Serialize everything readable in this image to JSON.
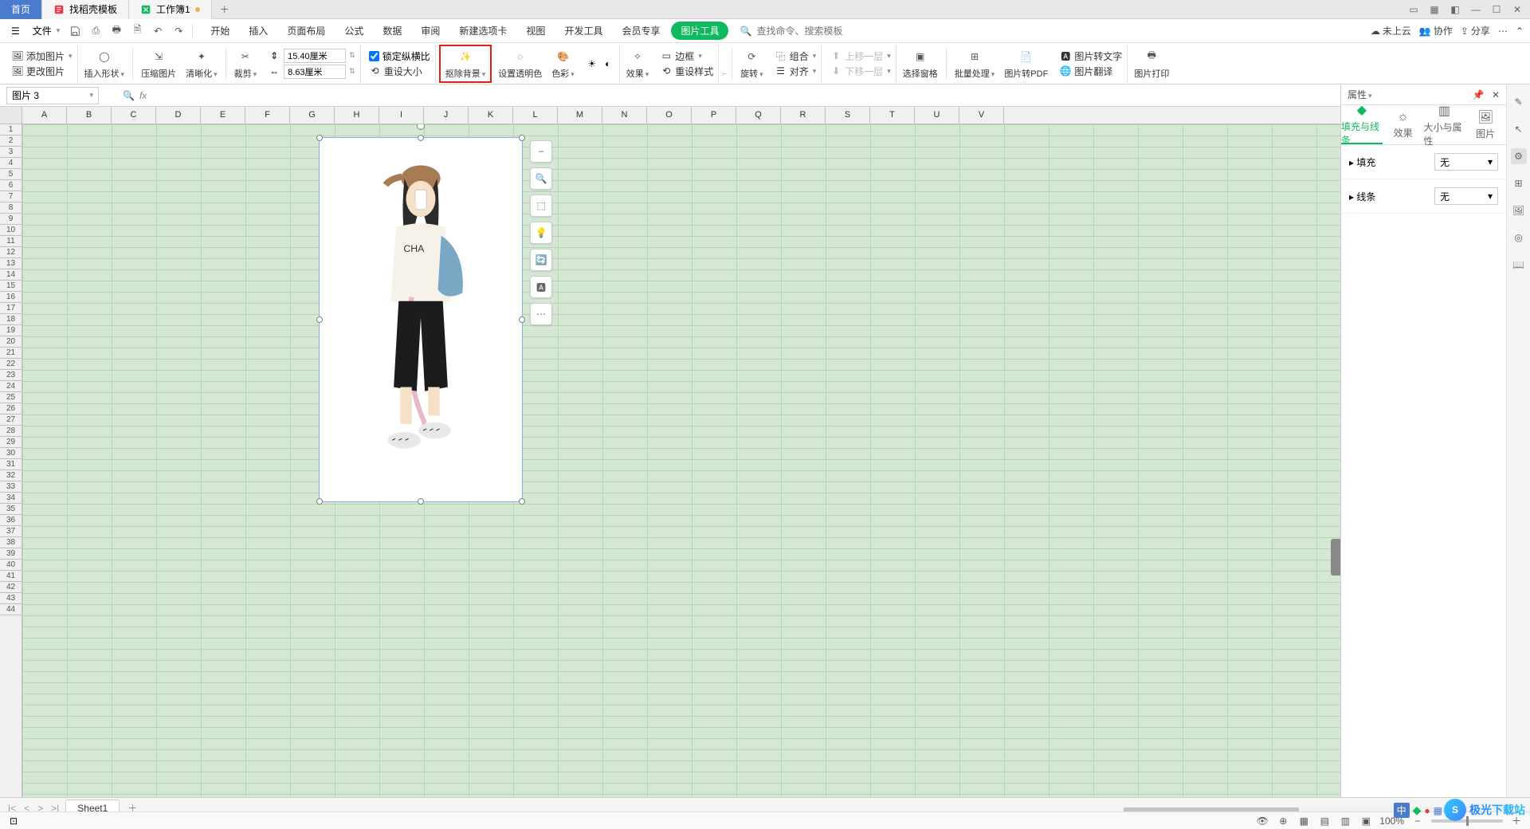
{
  "tabs": {
    "home": "首页",
    "template": "找稻壳模板",
    "workbook": "工作簿1"
  },
  "file_menu": "文件",
  "menu": {
    "items": [
      "开始",
      "插入",
      "页面布局",
      "公式",
      "数据",
      "审阅",
      "新建选项卡",
      "视图",
      "开发工具",
      "会员专享"
    ],
    "pic_tools": "图片工具",
    "search_placeholder": "查找命令、搜索模板",
    "right": {
      "cloud": "未上云",
      "collab": "协作",
      "share": "分享"
    }
  },
  "ribbon": {
    "add_image": "添加图片",
    "change_image": "更改图片",
    "insert_shape": "插入形状",
    "compress": "压缩图片",
    "sharpen": "清晰化",
    "crop": "裁剪",
    "height_val": "15.40厘米",
    "width_val": "8.63厘米",
    "lock_ratio": "锁定纵横比",
    "reset_size": "重设大小",
    "remove_bg": "抠除背景",
    "set_transparent": "设置透明色",
    "color": "色彩",
    "effect": "效果",
    "border": "边框",
    "reset_style": "重设样式",
    "rotate": "旋转",
    "group": "组合",
    "align": "对齐",
    "move_up": "上移一层",
    "move_down": "下移一层",
    "select_pane": "选择窗格",
    "batch": "批量处理",
    "to_pdf": "图片转PDF",
    "to_text": "图片转文字",
    "translate": "图片翻译",
    "print": "图片打印"
  },
  "name_box": "图片 3",
  "columns": [
    "A",
    "B",
    "C",
    "D",
    "E",
    "F",
    "G",
    "H",
    "I",
    "J",
    "K",
    "L",
    "M",
    "N",
    "O",
    "P",
    "Q",
    "R",
    "S",
    "T",
    "U",
    "V"
  ],
  "row_count": 44,
  "float_tools": [
    "zoom-out",
    "zoom-in",
    "crop",
    "highlight",
    "convert",
    "ocr",
    "more"
  ],
  "panel": {
    "title": "属性",
    "tabs": [
      "填充与线条",
      "效果",
      "大小与属性",
      "图片"
    ],
    "fill": "填充",
    "line": "线条",
    "none": "无"
  },
  "sheet": "Sheet1",
  "zoom": "100%",
  "watermark": "极光下载站",
  "ime": "中"
}
